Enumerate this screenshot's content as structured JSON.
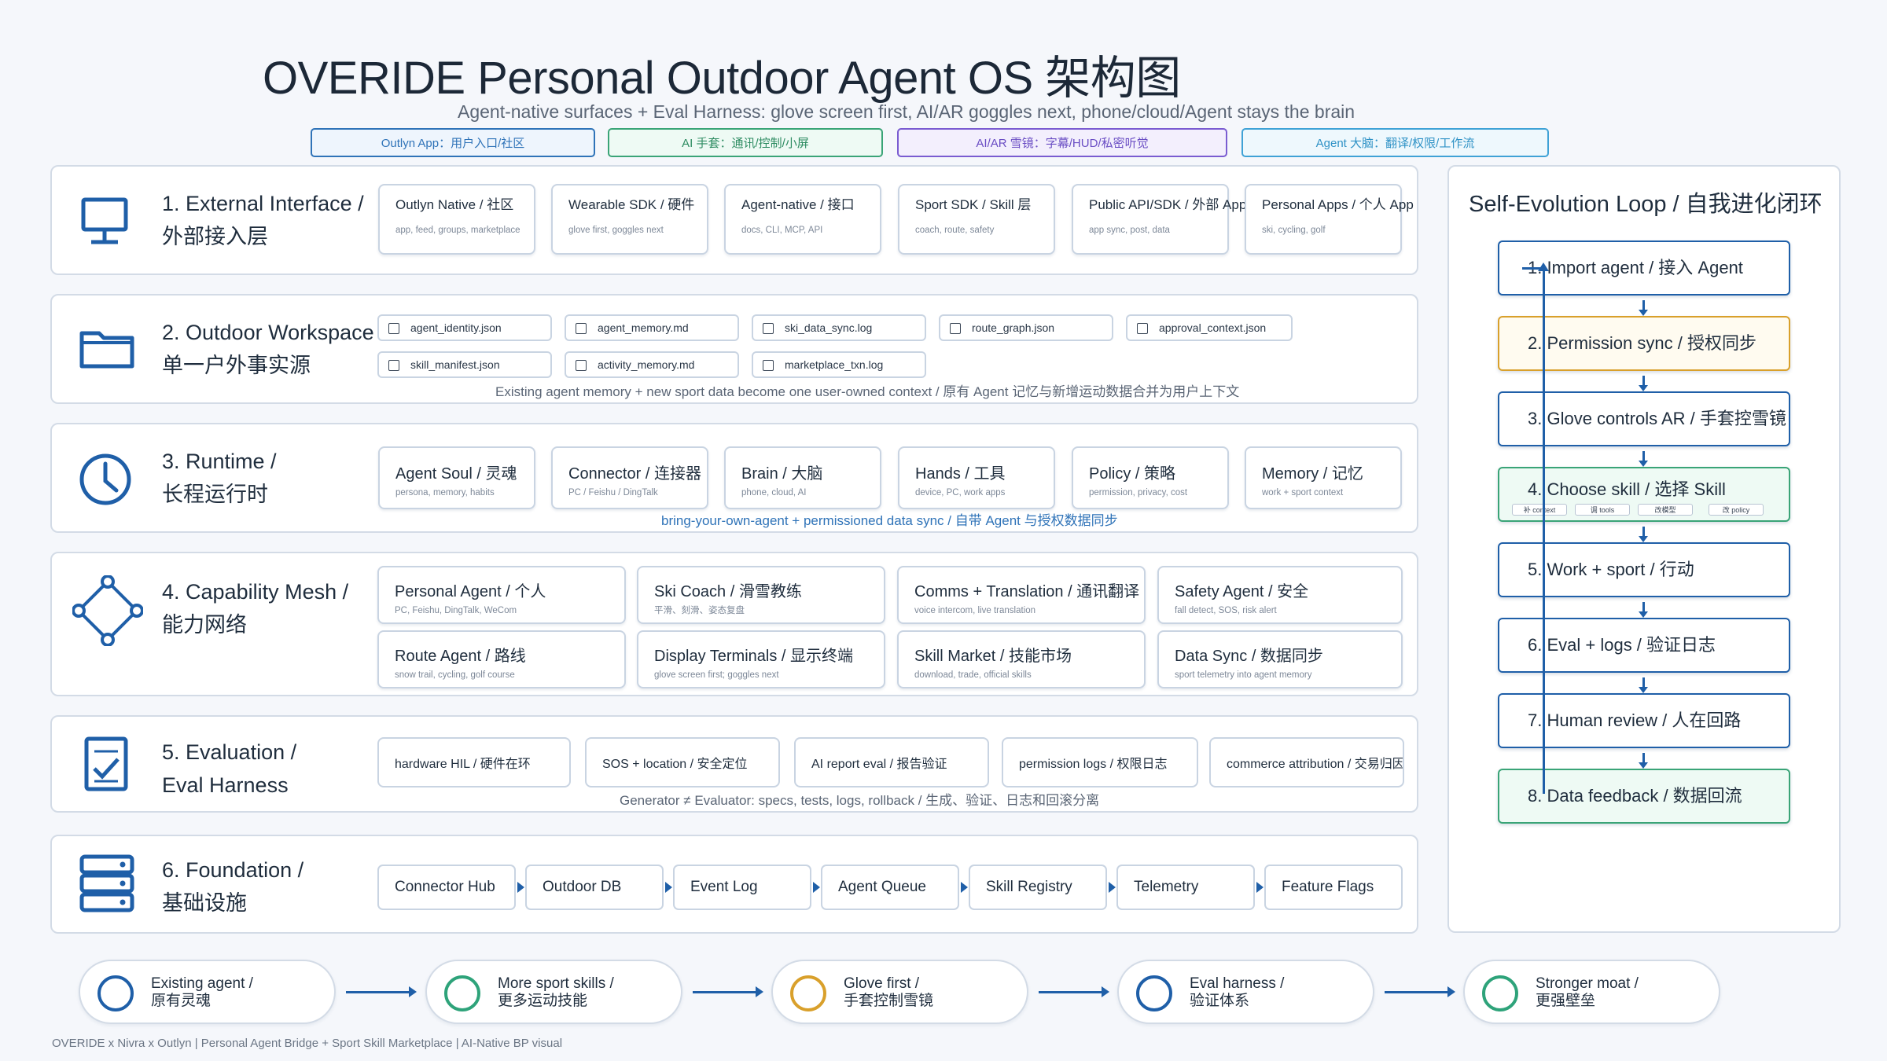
{
  "title": "OVERIDE Personal Outdoor Agent OS 架构图",
  "subtitle": "Agent-native surfaces + Eval Harness: glove screen first, AI/AR goggles next, phone/cloud/Agent stays the brain",
  "tags": [
    "Outlyn App：用户入口/社区",
    "AI 手套：通讯/控制/小屏",
    "AI/AR 雪镜：字幕/HUD/私密听觉",
    "Agent 大脑：翻译/权限/工作流"
  ],
  "layers": {
    "external": {
      "title1": "1. External Interface /",
      "title2": "外部接入层",
      "cards": [
        {
          "h": "Outlyn Native / 社区",
          "s": "app, feed, groups, marketplace"
        },
        {
          "h": "Wearable SDK / 硬件",
          "s": "glove first, goggles next"
        },
        {
          "h": "Agent-native / 接口",
          "s": "docs, CLI, MCP, API"
        },
        {
          "h": "Sport SDK / Skill 层",
          "s": "coach, route, safety"
        },
        {
          "h": "Public API/SDK / 外部 App",
          "s": "app sync, post, data"
        },
        {
          "h": "Personal Apps / 个人 App",
          "s": "ski, cycling, golf"
        }
      ]
    },
    "workspace": {
      "title1": "2. Outdoor Workspace /",
      "title2": "单一户外事实源",
      "files_row1": [
        "agent_identity.json",
        "agent_memory.md",
        "ski_data_sync.log",
        "route_graph.json",
        "approval_context.json"
      ],
      "files_row2": [
        "skill_manifest.json",
        "activity_memory.md",
        "marketplace_txn.log"
      ],
      "note": "Existing agent memory + new sport data become one user-owned context / 原有 Agent 记忆与新增运动数据合并为用户上下文"
    },
    "runtime": {
      "title1": "3. Runtime /",
      "title2": "长程运行时",
      "cards": [
        {
          "h": "Agent Soul / 灵魂",
          "s": "persona, memory, habits"
        },
        {
          "h": "Connector / 连接器",
          "s": "PC / Feishu / DingTalk"
        },
        {
          "h": "Brain / 大脑",
          "s": "phone, cloud, AI"
        },
        {
          "h": "Hands / 工具",
          "s": "device, PC, work apps"
        },
        {
          "h": "Policy / 策略",
          "s": "permission, privacy, cost"
        },
        {
          "h": "Memory / 记忆",
          "s": "work + sport context"
        }
      ],
      "note": "bring-your-own-agent + permissioned data sync / 自带 Agent 与授权数据同步"
    },
    "mesh": {
      "title1": "4. Capability Mesh /",
      "title2": "能力网络",
      "cards": [
        {
          "h": "Personal Agent / 个人",
          "s": "PC, Feishu, DingTalk, WeCom"
        },
        {
          "h": "Ski Coach / 滑雪教练",
          "s": "平滑、刻滑、姿态复盘"
        },
        {
          "h": "Comms + Translation / 通讯翻译",
          "s": "voice intercom, live translation"
        },
        {
          "h": "Safety Agent / 安全",
          "s": "fall detect, SOS, risk alert"
        },
        {
          "h": "Route Agent / 路线",
          "s": "snow trail, cycling, golf course"
        },
        {
          "h": "Display Terminals / 显示终端",
          "s": "glove screen first; goggles next"
        },
        {
          "h": "Skill Market / 技能市场",
          "s": "download, trade, official skills"
        },
        {
          "h": "Data Sync / 数据同步",
          "s": "sport telemetry into agent memory"
        }
      ]
    },
    "evaluation": {
      "title1": "5. Evaluation /",
      "title2": "Eval Harness",
      "items": [
        "hardware HIL / 硬件在环",
        "SOS + location / 安全定位",
        "AI report eval / 报告验证",
        "permission logs / 权限日志",
        "commerce attribution / 交易归因"
      ],
      "note": "Generator ≠ Evaluator: specs, tests, logs, rollback / 生成、验证、日志和回滚分离"
    },
    "foundation": {
      "title1": "6. Foundation /",
      "title2": "基础设施",
      "items": [
        "Connector Hub",
        "Outdoor DB",
        "Event Log",
        "Agent Queue",
        "Skill Registry",
        "Telemetry",
        "Feature Flags"
      ]
    }
  },
  "loop": {
    "title": "Self-Evolution Loop / 自我进化闭环",
    "steps": [
      "1. Import agent / 接入 Agent",
      "2. Permission sync / 授权同步",
      "3. Glove controls AR / 手套控雪镜",
      "4. Choose skill / 选择 Skill",
      "5. Work + sport / 行动",
      "6. Eval + logs / 验证日志",
      "7. Human review / 人在回路",
      "8. Data feedback / 数据回流"
    ],
    "mini": [
      "补 context",
      "调 tools",
      "改模型",
      "改 policy"
    ]
  },
  "bottom": [
    {
      "l1": "Existing agent /",
      "l2": "原有灵魂"
    },
    {
      "l1": "More sport skills /",
      "l2": "更多运动技能"
    },
    {
      "l1": "Glove first /",
      "l2": "手套控制雪镜"
    },
    {
      "l1": "Eval harness /",
      "l2": "验证体系"
    },
    {
      "l1": "Stronger moat /",
      "l2": "更强壁垒"
    }
  ],
  "footer": "OVERIDE x Nivra x Outlyn  |  Personal Agent Bridge + Sport Skill Marketplace  |  AI-Native BP visual"
}
